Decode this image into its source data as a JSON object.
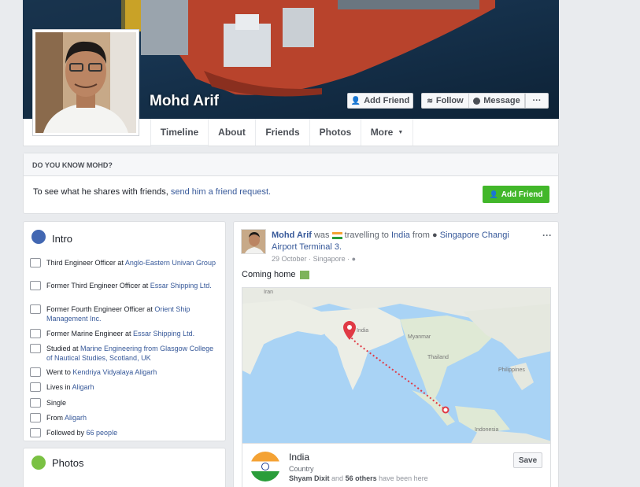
{
  "profile": {
    "name": "Mohd Arif"
  },
  "cover_buttons": {
    "add_friend": "Add Friend",
    "follow": "Follow",
    "message": "Message",
    "more": "···"
  },
  "tabs": [
    {
      "label": "Timeline"
    },
    {
      "label": "About"
    },
    {
      "label": "Friends"
    },
    {
      "label": "Photos"
    },
    {
      "label": "More"
    }
  ],
  "know": {
    "heading": "DO YOU KNOW MOHD?",
    "text": "To see what he shares with friends,",
    "link": "send him a friend request.",
    "button": "Add Friend"
  },
  "intro": {
    "title": "Intro",
    "items": [
      {
        "icon": "briefcase-icon",
        "pre": "Third Engineer Officer at ",
        "link": "Anglo-Eastern Univan Group"
      },
      {
        "icon": "briefcase-icon",
        "pre": "Former Third Engineer Officer at ",
        "link": "Essar Shipping Ltd."
      },
      {
        "icon": "briefcase-icon",
        "pre": "Former Fourth Engineer Officer at ",
        "link": "Orient Ship Management Inc."
      },
      {
        "icon": "briefcase-icon",
        "pre": "Former Marine Engineer at ",
        "link": "Essar Shipping Ltd."
      },
      {
        "icon": "graduation-cap-icon",
        "pre": "Studied at ",
        "link": "Marine Engineering from Glasgow College of Nautical Studies, Scotland, UK"
      },
      {
        "icon": "graduation-cap-icon",
        "pre": "Went to ",
        "link": "Kendriya Vidyalaya Aligarh"
      },
      {
        "icon": "home-icon",
        "pre": "Lives in ",
        "link": "Aligarh"
      },
      {
        "icon": "heart-icon",
        "pre": "Single",
        "link": ""
      },
      {
        "icon": "location-pin-icon",
        "pre": "From ",
        "link": "Aligarh"
      },
      {
        "icon": "followers-icon",
        "pre": "Followed by ",
        "link": "66 people"
      }
    ]
  },
  "photos": {
    "title": "Photos"
  },
  "post": {
    "author": "Mohd Arif",
    "was": "was",
    "travelling": "travelling to",
    "destination": "India",
    "from": "from",
    "origin": "Singapore Changi Airport Terminal 3.",
    "date": "29 October",
    "location": "Singapore",
    "sep": "·",
    "text": "Coming home",
    "menu": "···",
    "map_labels": {
      "iran": "Iran",
      "india": "India",
      "myanmar": "Myanmar",
      "thailand": "Thailand",
      "philippines": "Philippines",
      "indonesia": "Indonesia"
    },
    "place": {
      "name": "India",
      "type": "Country",
      "friends_link": "Shyam Dixit",
      "and": "and",
      "others_link": "56 others",
      "suffix": "have been here",
      "save": "Save"
    }
  }
}
